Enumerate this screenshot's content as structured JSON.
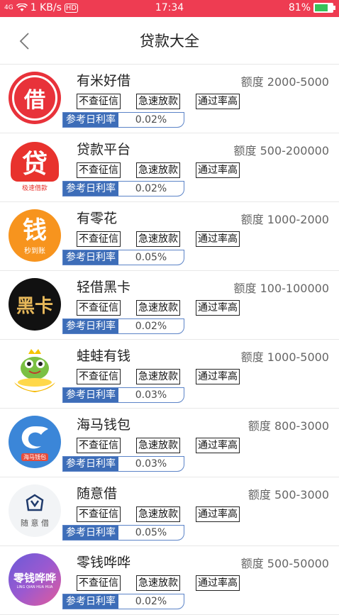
{
  "status": {
    "signal": "4G",
    "speed": "1 KB/s",
    "hd": "HD",
    "time": "17:34",
    "battery": "81%",
    "battery_level": 0.81
  },
  "header": {
    "title": "贷款大全"
  },
  "colors": {
    "status_bar": "#ee3c52",
    "rate_label_bg": "#3d6db8"
  },
  "loans": [
    {
      "name": "有米好借",
      "limit": "额度 2000-5000",
      "tags": [
        "不查征信",
        "急速放款",
        "通过率高"
      ],
      "rate_label": "参考日利率",
      "rate": "0.02%",
      "logo_text": "借",
      "logo_sub": ""
    },
    {
      "name": "贷款平台",
      "limit": "额度 500-200000",
      "tags": [
        "不查征信",
        "急速放款",
        "通过率高"
      ],
      "rate_label": "参考日利率",
      "rate": "0.02%",
      "logo_text": "贷",
      "logo_sub": "极速借款"
    },
    {
      "name": "有零花",
      "limit": "额度 1000-2000",
      "tags": [
        "不查征信",
        "急速放款",
        "通过率高"
      ],
      "rate_label": "参考日利率",
      "rate": "0.05%",
      "logo_text": "钱",
      "logo_sub": "秒到账"
    },
    {
      "name": "轻借黑卡",
      "limit": "额度 100-100000",
      "tags": [
        "不查征信",
        "急速放款",
        "通过率高"
      ],
      "rate_label": "参考日利率",
      "rate": "0.02%",
      "logo_text": "黑卡",
      "logo_sub": ""
    },
    {
      "name": "蛙蛙有钱",
      "limit": "额度 1000-5000",
      "tags": [
        "不查征信",
        "急速放款",
        "通过率高"
      ],
      "rate_label": "参考日利率",
      "rate": "0.03%",
      "logo_text": "",
      "logo_sub": ""
    },
    {
      "name": "海马钱包",
      "limit": "额度 800-3000",
      "tags": [
        "不查征信",
        "急速放款",
        "通过率高"
      ],
      "rate_label": "参考日利率",
      "rate": "0.03%",
      "logo_text": "",
      "logo_sub": "海马钱包"
    },
    {
      "name": "随意借",
      "limit": "额度 500-3000",
      "tags": [
        "不查征信",
        "急速放款",
        "通过率高"
      ],
      "rate_label": "参考日利率",
      "rate": "0.05%",
      "logo_text": "",
      "logo_sub": "随 意 借"
    },
    {
      "name": "零钱哗哗",
      "limit": "额度 500-50000",
      "tags": [
        "不查征信",
        "急速放款",
        "通过率高"
      ],
      "rate_label": "参考日利率",
      "rate": "0.02%",
      "logo_text": "零钱哗哗",
      "logo_sub": "LING QIAN HUA HUA"
    }
  ]
}
